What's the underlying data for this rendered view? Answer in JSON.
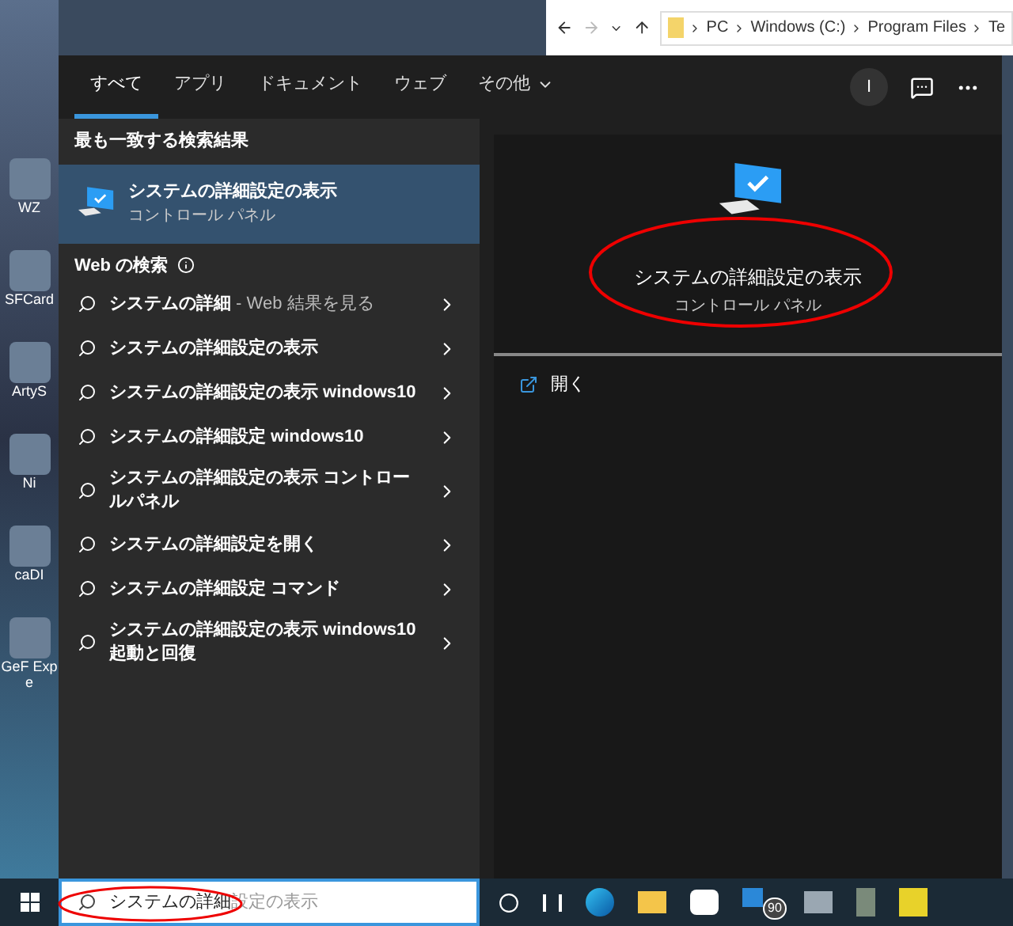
{
  "desktop": {
    "icons": [
      {
        "label": "WZ"
      },
      {
        "label": "SFCard"
      },
      {
        "label": "ArtyS"
      },
      {
        "label": "Ni"
      },
      {
        "label": "caDI"
      },
      {
        "label": "GeF Expe"
      }
    ]
  },
  "explorer": {
    "breadcrumb": [
      "PC",
      "Windows (C:)",
      "Program Files",
      "Te"
    ]
  },
  "tabs": [
    {
      "label": "すべて",
      "selected": true
    },
    {
      "label": "アプリ",
      "selected": false
    },
    {
      "label": "ドキュメント",
      "selected": false
    },
    {
      "label": "ウェブ",
      "selected": false
    },
    {
      "label": "その他",
      "selected": false,
      "dropdown": true
    }
  ],
  "profile": {
    "initial": "I"
  },
  "best_match": {
    "heading": "最も一致する検索結果",
    "title": "システムの詳細設定の表示",
    "subtitle": "コントロール パネル",
    "selected": true
  },
  "web_search": {
    "heading": "Web の検索",
    "items": [
      {
        "text": "システムの詳細",
        "suffix": "- Web 結果を見る"
      },
      {
        "text": "システムの詳細設定の表示"
      },
      {
        "text": "システムの詳細設定の表示 windows10"
      },
      {
        "text": "システムの詳細設定 windows10"
      },
      {
        "text": "システムの詳細設定の表示 コントロールパネル"
      },
      {
        "text": "システムの詳細設定を開く"
      },
      {
        "text": "システムの詳細設定 コマンド"
      },
      {
        "text": "システムの詳細設定の表示 windows10 起動と回復"
      }
    ]
  },
  "preview": {
    "title": "システムの詳細設定の表示",
    "subtitle": "コントロール パネル",
    "actions": [
      {
        "label": "開く"
      }
    ]
  },
  "search": {
    "value": "システムの詳細",
    "completion": "設定の表示"
  },
  "taskbar": {
    "mail_badge": "90"
  }
}
